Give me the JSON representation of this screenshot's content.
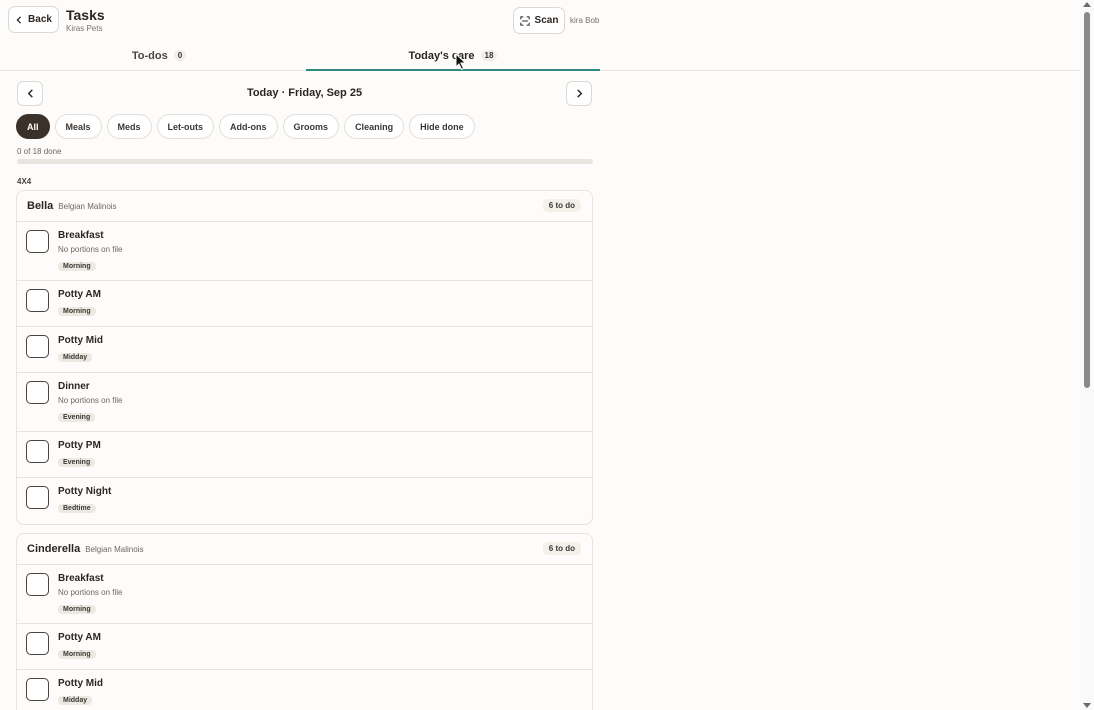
{
  "header": {
    "back_label": "Back",
    "title": "Tasks",
    "subtitle": "Kiras Pets",
    "scan_label": "Scan",
    "user_name": "kira Bob"
  },
  "tabs": [
    {
      "label": "To-dos",
      "count": "0",
      "active": false
    },
    {
      "label": "Today's care",
      "count": "18",
      "active": true
    }
  ],
  "date_nav": {
    "label": "Today · Friday, Sep 25",
    "prev_icon": "chevron-left-icon",
    "next_icon": "chevron-right-icon"
  },
  "filters": [
    "All",
    "Meals",
    "Meds",
    "Let-outs",
    "Add-ons",
    "Grooms",
    "Cleaning",
    "Hide done"
  ],
  "active_filter": "All",
  "progress": {
    "text": "0 of 18 done",
    "done": 0,
    "total": 18
  },
  "group_label": "4X4",
  "pets": [
    {
      "name": "Bella",
      "breed": "Belgian Malinois",
      "badge": "6 to do",
      "tasks": [
        {
          "name": "Breakfast",
          "note": "No portions on file",
          "tag": "Morning"
        },
        {
          "name": "Potty AM",
          "note": "",
          "tag": "Morning"
        },
        {
          "name": "Potty Mid",
          "note": "",
          "tag": "Midday"
        },
        {
          "name": "Dinner",
          "note": "No portions on file",
          "tag": "Evening"
        },
        {
          "name": "Potty PM",
          "note": "",
          "tag": "Evening"
        },
        {
          "name": "Potty Night",
          "note": "",
          "tag": "Bedtime"
        }
      ]
    },
    {
      "name": "Cinderella",
      "breed": "Belgian Malinois",
      "badge": "6 to do",
      "tasks": [
        {
          "name": "Breakfast",
          "note": "No portions on file",
          "tag": "Morning"
        },
        {
          "name": "Potty AM",
          "note": "",
          "tag": "Morning"
        },
        {
          "name": "Potty Mid",
          "note": "",
          "tag": "Midday"
        }
      ]
    }
  ],
  "colors": {
    "accent": "#2e8a7e",
    "active_chip": "#3a312b",
    "background": "#fdfcfa"
  }
}
